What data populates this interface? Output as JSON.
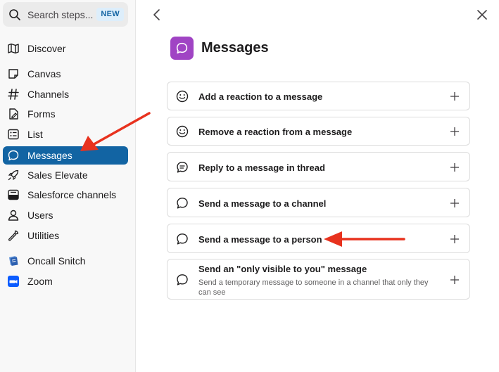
{
  "sidebar": {
    "search": {
      "placeholder": "Search steps...",
      "badge": "NEW"
    },
    "items": [
      {
        "label": "Discover",
        "icon": "map-icon"
      },
      {
        "label": "Canvas",
        "icon": "canvas-icon"
      },
      {
        "label": "Channels",
        "icon": "hash-icon"
      },
      {
        "label": "Forms",
        "icon": "forms-icon"
      },
      {
        "label": "List",
        "icon": "list-icon"
      },
      {
        "label": "Messages",
        "icon": "message-bubble-icon",
        "active": true
      },
      {
        "label": "Sales Elevate",
        "icon": "rocket-icon"
      },
      {
        "label": "Salesforce channels",
        "icon": "salesforce-channel-icon"
      },
      {
        "label": "Users",
        "icon": "user-icon"
      },
      {
        "label": "Utilities",
        "icon": "wrench-icon"
      },
      {
        "label": "Oncall Snitch",
        "icon": "oncall-snitch-app-icon"
      },
      {
        "label": "Zoom",
        "icon": "zoom-app-icon"
      }
    ]
  },
  "main": {
    "title": "Messages",
    "title_icon_color": "#a044c4",
    "actions": [
      {
        "label": "Add a reaction to a message",
        "icon": "smiley-icon"
      },
      {
        "label": "Remove a reaction from a message",
        "icon": "smiley-icon"
      },
      {
        "label": "Reply to a message in thread",
        "icon": "thread-reply-icon"
      },
      {
        "label": "Send a message to a channel",
        "icon": "message-bubble-icon"
      },
      {
        "label": "Send a message to a person",
        "icon": "message-bubble-icon"
      },
      {
        "label": "Send an \"only visible to you\" message",
        "description": "Send a temporary message to someone in a channel that only they can see",
        "icon": "message-bubble-icon"
      }
    ]
  },
  "colors": {
    "accent": "#1264a3",
    "annotation_arrow": "#e8321e",
    "badge_bg": "#ddeefb"
  }
}
